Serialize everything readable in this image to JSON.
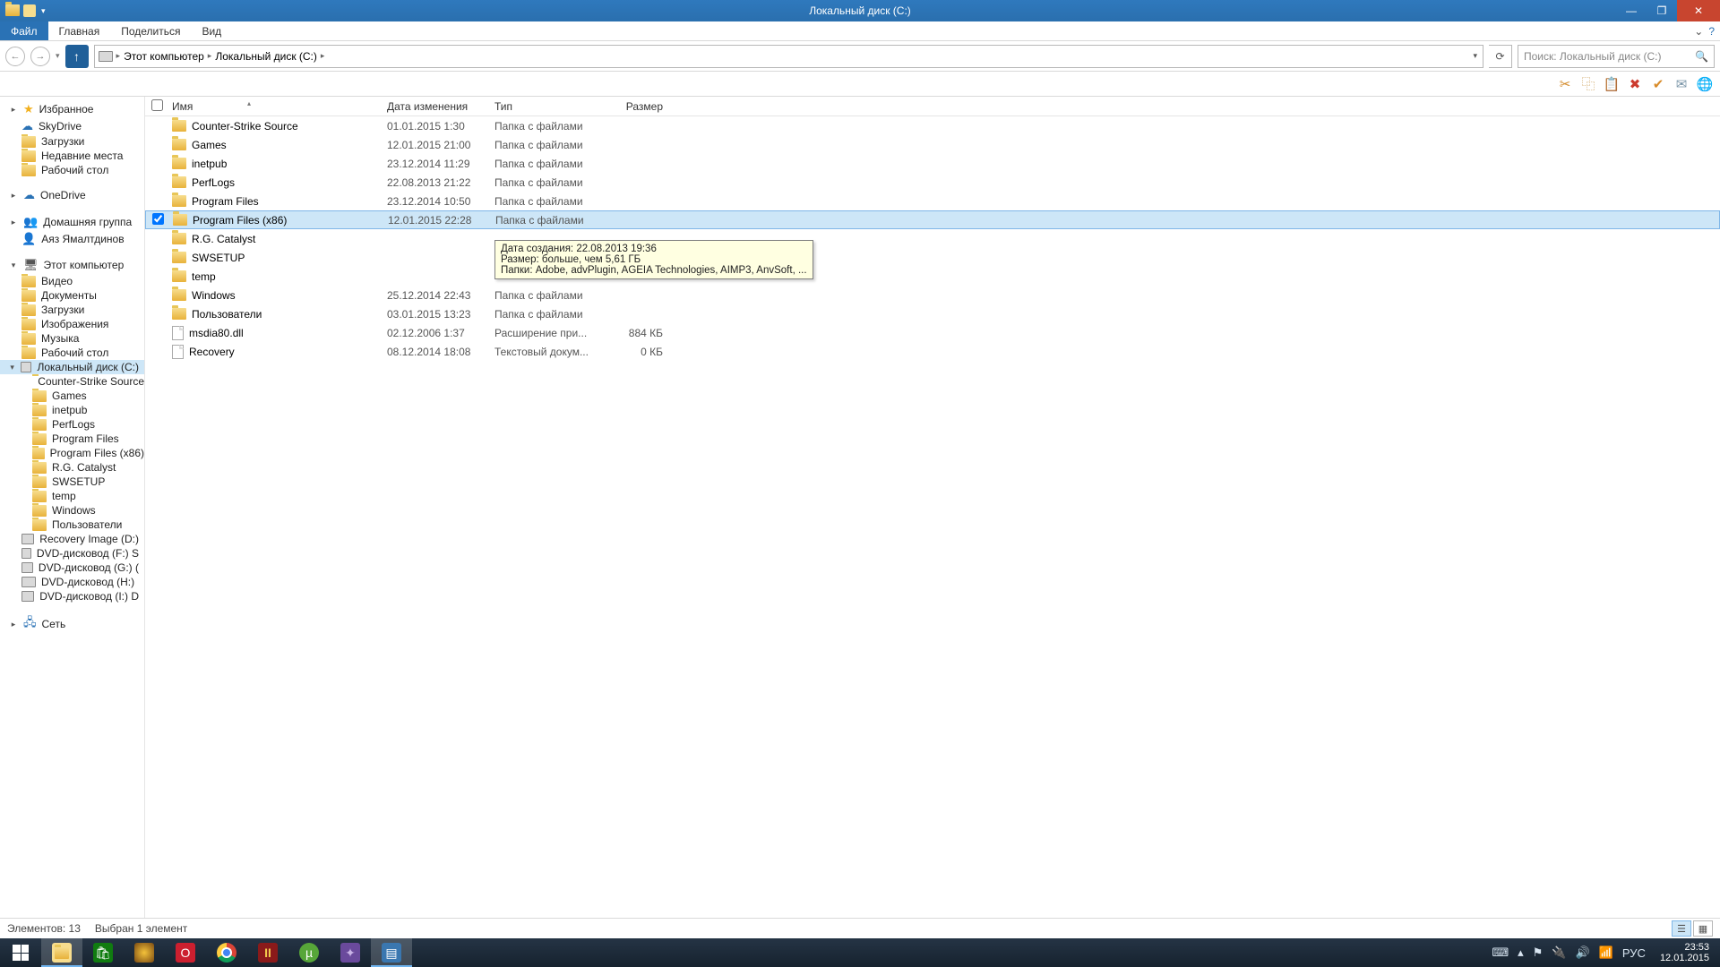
{
  "window": {
    "title": "Локальный диск (C:)"
  },
  "ribbon": {
    "file": "Файл",
    "home": "Главная",
    "share": "Поделиться",
    "view": "Вид"
  },
  "breadcrumb": {
    "root": "Этот компьютер",
    "path": "Локальный диск (C:)"
  },
  "search": {
    "placeholder": "Поиск: Локальный диск (C:)"
  },
  "columns": {
    "name": "Имя",
    "modified": "Дата изменения",
    "type": "Тип",
    "size": "Размер"
  },
  "rows": [
    {
      "icon": "folder",
      "name": "Counter-Strike Source",
      "mod": "01.01.2015 1:30",
      "type": "Папка с файлами",
      "size": ""
    },
    {
      "icon": "folder",
      "name": "Games",
      "mod": "12.01.2015 21:00",
      "type": "Папка с файлами",
      "size": ""
    },
    {
      "icon": "folder",
      "name": "inetpub",
      "mod": "23.12.2014 11:29",
      "type": "Папка с файлами",
      "size": ""
    },
    {
      "icon": "folder",
      "name": "PerfLogs",
      "mod": "22.08.2013 21:22",
      "type": "Папка с файлами",
      "size": ""
    },
    {
      "icon": "folder",
      "name": "Program Files",
      "mod": "23.12.2014 10:50",
      "type": "Папка с файлами",
      "size": ""
    },
    {
      "icon": "folder",
      "name": "Program Files (x86)",
      "mod": "12.01.2015 22:28",
      "type": "Папка с файлами",
      "size": "",
      "selected": true
    },
    {
      "icon": "folder",
      "name": "R.G. Catalyst",
      "mod": "",
      "type": "",
      "size": ""
    },
    {
      "icon": "folder",
      "name": "SWSETUP",
      "mod": "",
      "type": "",
      "size": ""
    },
    {
      "icon": "folder",
      "name": "temp",
      "mod": "",
      "type": "",
      "size": ""
    },
    {
      "icon": "folder",
      "name": "Windows",
      "mod": "25.12.2014 22:43",
      "type": "Папка с файлами",
      "size": ""
    },
    {
      "icon": "folder",
      "name": "Пользователи",
      "mod": "03.01.2015 13:23",
      "type": "Папка с файлами",
      "size": ""
    },
    {
      "icon": "file",
      "name": "msdia80.dll",
      "mod": "02.12.2006 1:37",
      "type": "Расширение при...",
      "size": "884 КБ"
    },
    {
      "icon": "file",
      "name": "Recovery",
      "mod": "08.12.2014 18:08",
      "type": "Текстовый докум...",
      "size": "0 КБ"
    }
  ],
  "tooltip": {
    "line1": "Дата создания: 22.08.2013 19:36",
    "line2": "Размер: больше, чем 5,61 ГБ",
    "line3": "Папки: Adobe, advPlugin, AGEIA Technologies, AIMP3, AnvSoft, ..."
  },
  "nav": {
    "favorites": "Избранное",
    "fav_items": [
      "SkyDrive",
      "Загрузки",
      "Недавние места",
      "Рабочий стол"
    ],
    "onedrive": "OneDrive",
    "homegroup": "Домашняя группа",
    "hg_user": "Аяз Ямалтдинов",
    "thispc": "Этот компьютер",
    "pc_items": [
      "Видео",
      "Документы",
      "Загрузки",
      "Изображения",
      "Музыка",
      "Рабочий стол"
    ],
    "pc_drive": "Локальный диск (C:)",
    "pc_drive_children": [
      "Counter-Strike Source",
      "Games",
      "inetpub",
      "PerfLogs",
      "Program Files",
      "Program Files (x86)",
      "R.G. Catalyst",
      "SWSETUP",
      "temp",
      "Windows",
      "Пользователи"
    ],
    "other_drives": [
      "Recovery Image (D:)",
      "DVD-дисковод (F:) S",
      "DVD-дисковод (G:) (",
      "DVD-дисковод (H:)",
      "DVD-дисковод (I:) D"
    ],
    "network": "Сеть"
  },
  "status": {
    "items": "Элементов: 13",
    "selected": "Выбран 1 элемент"
  },
  "tray": {
    "lang": "РУС",
    "time": "23:53",
    "date": "12.01.2015"
  }
}
